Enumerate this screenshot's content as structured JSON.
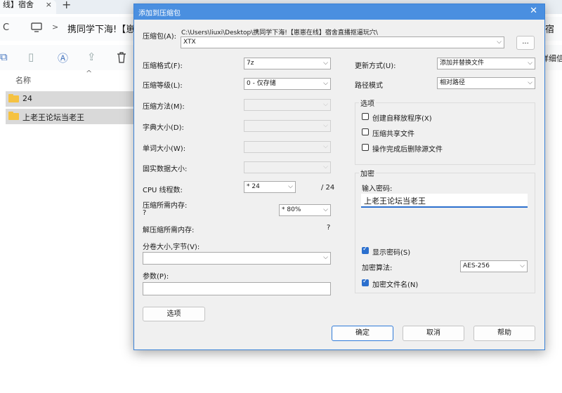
{
  "explorer": {
    "tab_title": "线】宿舍",
    "tab_close": "×",
    "new_tab": "+",
    "refresh_glyph": "C",
    "path_arrow": ">",
    "path_text": "携同学下海!【崽",
    "col_name": "名称",
    "sort_glyph": "^",
    "right_cut_1": "宿",
    "right_cut_2": "详细信",
    "rows": [
      {
        "name": "24"
      },
      {
        "name": "上老王论坛当老王"
      }
    ]
  },
  "dialog": {
    "title": "添加到压缩包",
    "close": "✕",
    "archive_label": "压缩包(A):",
    "archive_path": "C:\\Users\\liuxi\\Desktop\\携同学下海!【崽崽在线】宿舍直播抠逼玩穴\\",
    "archive_name": "XTX",
    "browse_label": "...",
    "left": {
      "format_label": "压缩格式(F):",
      "format_value": "7z",
      "level_label": "压缩等级(L):",
      "level_value": "0 - 仅存储",
      "method_label": "压缩方法(M):",
      "dict_label": "字典大小(D):",
      "word_label": "单词大小(W):",
      "solid_label": "固实数据大小:",
      "cpu_label": "CPU 线程数:",
      "cpu_value": "* 24",
      "cpu_total": "/ 24",
      "mem_label": "压缩所需内存:",
      "mem_q": "?",
      "mem_value": "* 80%",
      "decomp_label": "解压缩所需内存:",
      "decomp_q": "?",
      "split_label": "分卷大小,字节(V):",
      "params_label": "参数(P):",
      "options_btn": "选项"
    },
    "right": {
      "update_label": "更新方式(U):",
      "update_value": "添加并替换文件",
      "path_label": "路径模式",
      "path_value": "相对路径",
      "options_group": "选项",
      "opt_sfx": "创建自释放程序(X)",
      "opt_shared": "压缩共享文件",
      "opt_delete": "操作完成后删除源文件",
      "enc_group": "加密",
      "pwd_label": "输入密码:",
      "pwd_value": "上老王论坛当老王",
      "show_pwd": "显示密码(S)",
      "enc_method_label": "加密算法:",
      "enc_method_value": "AES-256",
      "enc_names": "加密文件名(N)"
    },
    "ok": "确定",
    "cancel": "取消",
    "help": "帮助"
  },
  "icons": [
    "refresh-icon",
    "monitor-icon",
    "copy-icon",
    "paste-icon",
    "rename-icon",
    "share-icon",
    "delete-icon",
    "folder-icon",
    "chevron-down-icon",
    "mouse-cursor-icon"
  ],
  "colors": {
    "title_bar": "#4a8fe0",
    "folder": "#f5c242",
    "checkbox_checked": "#2b6fce"
  }
}
